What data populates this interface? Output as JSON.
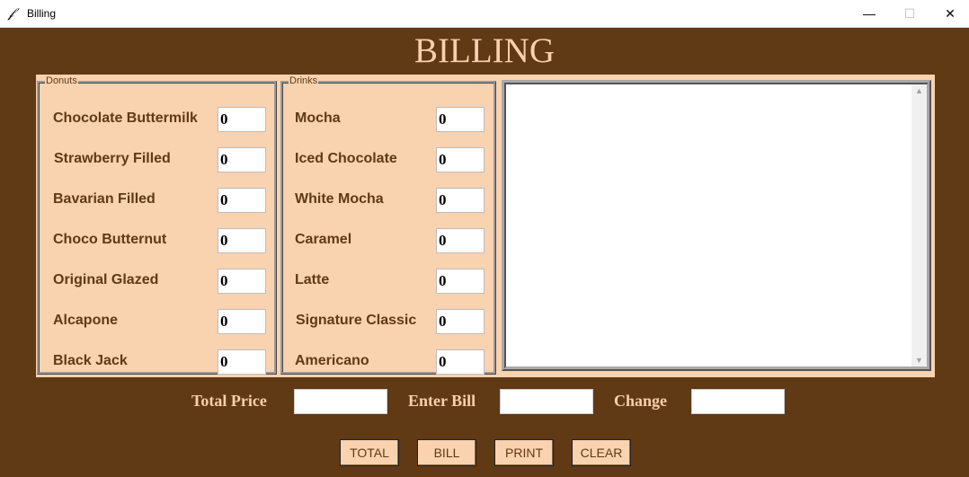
{
  "window": {
    "title": "Billing",
    "min_glyph": "—",
    "max_glyph": "☐",
    "close_glyph": "✕",
    "icon": "feather-icon"
  },
  "header": {
    "title": "BILLING"
  },
  "donuts": {
    "label": "Donuts",
    "items": [
      {
        "name": "Chocolate Buttermilk",
        "qty": "0"
      },
      {
        "name": "Strawberry Filled",
        "qty": "0"
      },
      {
        "name": "Bavarian Filled",
        "qty": "0"
      },
      {
        "name": "Choco Butternut",
        "qty": "0"
      },
      {
        "name": "Original Glazed",
        "qty": "0"
      },
      {
        "name": "Alcapone",
        "qty": "0"
      },
      {
        "name": "Black Jack",
        "qty": "0"
      }
    ]
  },
  "drinks": {
    "label": "Drinks",
    "items": [
      {
        "name": "Mocha",
        "qty": "0"
      },
      {
        "name": "Iced Chocolate",
        "qty": "0"
      },
      {
        "name": "White Mocha",
        "qty": "0"
      },
      {
        "name": "Caramel",
        "qty": "0"
      },
      {
        "name": "Latte",
        "qty": "0"
      },
      {
        "name": "Signature Classic",
        "qty": "0"
      },
      {
        "name": "Americano",
        "qty": "0"
      }
    ]
  },
  "totals": {
    "total_price_label": "Total Price",
    "total_price_value": "",
    "enter_bill_label": "Enter Bill",
    "enter_bill_value": "",
    "change_label": "Change",
    "change_value": ""
  },
  "buttons": {
    "total": "TOTAL",
    "bill": "BILL",
    "print": "PRINT",
    "clear": "CLEAR"
  },
  "colors": {
    "background": "#603915",
    "panel": "#f9d2b0",
    "title_text": "#f8d0ae"
  }
}
